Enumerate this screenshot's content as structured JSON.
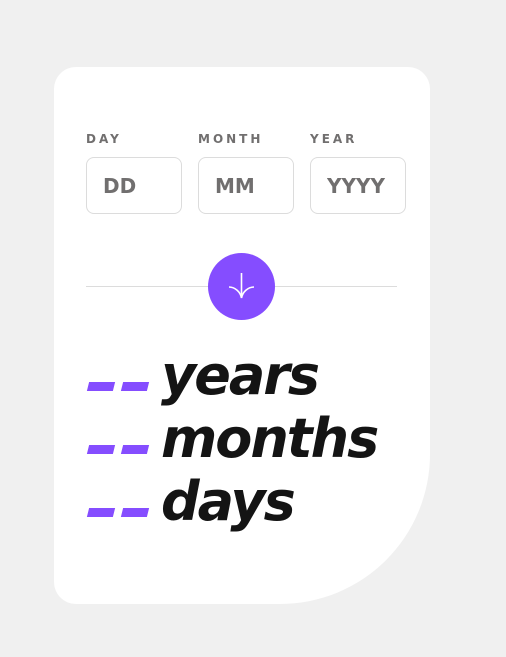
{
  "form": {
    "day": {
      "label": "DAY",
      "placeholder": "DD"
    },
    "month": {
      "label": "MONTH",
      "placeholder": "MM"
    },
    "year": {
      "label": "YEAR",
      "placeholder": "YYYY"
    }
  },
  "submit": {
    "icon": "arrow-down-icon"
  },
  "results": [
    {
      "value": "--",
      "unit": "years"
    },
    {
      "value": "--",
      "unit": "months"
    },
    {
      "value": "--",
      "unit": "days"
    }
  ],
  "colors": {
    "accent": "#854dff",
    "background": "#f0f0f0",
    "card": "#ffffff",
    "text": "#141414",
    "muted": "#716f6f",
    "border": "#dcdcdc"
  }
}
